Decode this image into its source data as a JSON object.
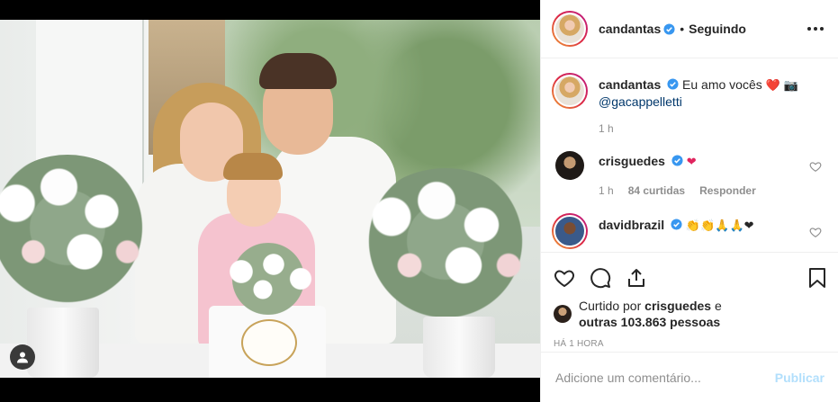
{
  "post": {
    "author": "candantas",
    "follow_status": "Seguindo",
    "separator": "•"
  },
  "comments": [
    {
      "username": "candantas",
      "text": "Eu amo vocês",
      "emojis": "❤️ 📷",
      "mention": "@gacappelletti",
      "time": "1 h"
    },
    {
      "username": "crisguedes",
      "text": "",
      "emojis": "❤",
      "time": "1 h",
      "likes": "84 curtidas",
      "reply": "Responder"
    },
    {
      "username": "davidbrazil",
      "text": "",
      "emojis": "👏👏🙏🙏❤"
    }
  ],
  "likes": {
    "prefix": "Curtido por",
    "user": "crisguedes",
    "conjunction": "e",
    "others": "outras 103.863 pessoas"
  },
  "time_ago": "HÁ 1 HORA",
  "comment_box": {
    "placeholder": "Adicione um comentário...",
    "publish": "Publicar"
  },
  "colors": {
    "verified": "#3897f0",
    "publish_disabled": "#b2dffc",
    "text": "#262626",
    "muted": "#8e8e8e"
  },
  "icons": [
    "more-options-icon",
    "verified-badge-icon",
    "like-icon",
    "comment-icon",
    "share-icon",
    "save-icon",
    "user-tag-icon",
    "comment-like-icon"
  ]
}
